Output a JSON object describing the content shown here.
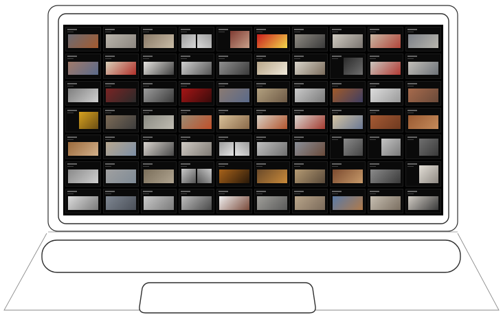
{
  "screen": {
    "rows": 7,
    "cols": 10,
    "slides": [
      {
        "layout": "wide",
        "bg": "#0a0a0a",
        "photo": "#6b6b73",
        "accent": "#a35a2e"
      },
      {
        "layout": "wide",
        "bg": "#0a0a0a",
        "photo": "#b9b4aa",
        "accent": "#8c8680"
      },
      {
        "layout": "wide",
        "bg": "#0a0a0a",
        "photo": "#8a7a68",
        "accent": "#c9bca6"
      },
      {
        "layout": "split",
        "bg": "#0a0a0a",
        "photo": "#9d9d9d",
        "accent": "#d8d8d8"
      },
      {
        "layout": "right",
        "bg": "#0a0a0a",
        "photo": "#7f3b32",
        "accent": "#c9a08a"
      },
      {
        "layout": "wide",
        "bg": "#0a0a0a",
        "photo": "#c91d1d",
        "accent": "#f2d84b"
      },
      {
        "layout": "wide",
        "bg": "#0a0a0a",
        "photo": "#8e8a82",
        "accent": "#3a3a3a"
      },
      {
        "layout": "wide",
        "bg": "#0a0a0a",
        "photo": "#cfcac0",
        "accent": "#7a7570"
      },
      {
        "layout": "wide",
        "bg": "#0a0a0a",
        "photo": "#c9b7a3",
        "accent": "#b2453a"
      },
      {
        "layout": "wide",
        "bg": "#0a0a0a",
        "photo": "#7c8087",
        "accent": "#b8b6ae"
      },
      {
        "layout": "wide",
        "bg": "#0a0a0a",
        "photo": "#a07a6a",
        "accent": "#5a6a8a"
      },
      {
        "layout": "wide",
        "bg": "#0a0a0a",
        "photo": "#d9cfb8",
        "accent": "#b0302a"
      },
      {
        "layout": "wide",
        "bg": "#0a0a0a",
        "photo": "#e6e4e0",
        "accent": "#404040"
      },
      {
        "layout": "wide",
        "bg": "#0a0a0a",
        "photo": "#cfcfcf",
        "accent": "#555555"
      },
      {
        "layout": "wide",
        "bg": "#0a0a0a",
        "photo": "#8f8f8f",
        "accent": "#3a3a3a"
      },
      {
        "layout": "wide",
        "bg": "#0a0a0a",
        "photo": "#b9a78a",
        "accent": "#efe8da"
      },
      {
        "layout": "wide",
        "bg": "#0a0a0a",
        "photo": "#d8d4ca",
        "accent": "#7a6c5c"
      },
      {
        "layout": "right",
        "bg": "#0a0a0a",
        "photo": "#2a2a2a",
        "accent": "#6f6f6f"
      },
      {
        "layout": "wide",
        "bg": "#0a0a0a",
        "photo": "#c9c5bd",
        "accent": "#b23a34"
      },
      {
        "layout": "wide",
        "bg": "#0a0a0a",
        "photo": "#c2bfb9",
        "accent": "#6d7278"
      },
      {
        "layout": "wide",
        "bg": "#0a0a0a",
        "photo": "#7f7f7f",
        "accent": "#d0d0d0"
      },
      {
        "layout": "wide",
        "bg": "#0a0a0a",
        "photo": "#7a2424",
        "accent": "#2a2a2a"
      },
      {
        "layout": "wide",
        "bg": "#0a0a0a",
        "photo": "#9c9c9c",
        "accent": "#3b3b3b"
      },
      {
        "layout": "wide",
        "bg": "#0a0a0a",
        "photo": "#a51616",
        "accent": "#3a0b0b"
      },
      {
        "layout": "wide",
        "bg": "#0a0a0a",
        "photo": "#8a7a72",
        "accent": "#5a6a8a"
      },
      {
        "layout": "wide",
        "bg": "#0a0a0a",
        "photo": "#b2a07f",
        "accent": "#6e5a46"
      },
      {
        "layout": "wide",
        "bg": "#0a0a0a",
        "photo": "#c9c9c9",
        "accent": "#7b7b7b"
      },
      {
        "layout": "wide",
        "bg": "#0a0a0a",
        "photo": "#a05a2a",
        "accent": "#3f3f63"
      },
      {
        "layout": "wide",
        "bg": "#0a0a0a",
        "photo": "#dcdcdc",
        "accent": "#9b9b9b"
      },
      {
        "layout": "wide",
        "bg": "#0a0a0a",
        "photo": "#a66a4c",
        "accent": "#6a4a3a"
      },
      {
        "layout": "right",
        "bg": "#0a0a0a",
        "photo": "#d6a11f",
        "accent": "#6b4e14"
      },
      {
        "layout": "wide",
        "bg": "#0a0a0a",
        "photo": "#7b6a56",
        "accent": "#3d3d3d"
      },
      {
        "layout": "wide",
        "bg": "#0a0a0a",
        "photo": "#8b8b83",
        "accent": "#c0bcb2"
      },
      {
        "layout": "wide",
        "bg": "#0a0a0a",
        "photo": "#9a8b73",
        "accent": "#c0502a"
      },
      {
        "layout": "wide",
        "bg": "#0a0a0a",
        "photo": "#d8c098",
        "accent": "#8a6a4a"
      },
      {
        "layout": "wide",
        "bg": "#0a0a0a",
        "photo": "#d7cfc3",
        "accent": "#b3562f"
      },
      {
        "layout": "wide",
        "bg": "#0a0a0a",
        "photo": "#d9d5cf",
        "accent": "#a33b30"
      },
      {
        "layout": "wide",
        "bg": "#0a0a0a",
        "photo": "#d3c3a3",
        "accent": "#6a7894"
      },
      {
        "layout": "wide",
        "bg": "#0a0a0a",
        "photo": "#a55a34",
        "accent": "#6f3a20"
      },
      {
        "layout": "wide",
        "bg": "#0a0a0a",
        "photo": "#9a5a32",
        "accent": "#c48a5a"
      },
      {
        "layout": "wide",
        "bg": "#0a0a0a",
        "photo": "#9b6a3c",
        "accent": "#d2b08a"
      },
      {
        "layout": "wide",
        "bg": "#0a0a0a",
        "photo": "#b8a890",
        "accent": "#7c8fa6"
      },
      {
        "layout": "wide",
        "bg": "#0a0a0a",
        "photo": "#d9d4ce",
        "accent": "#4a4a4a"
      },
      {
        "layout": "wide",
        "bg": "#0a0a0a",
        "photo": "#cfcac3",
        "accent": "#7f7a74"
      },
      {
        "layout": "split",
        "bg": "#0a0a0a",
        "photo": "#9d9d9d",
        "accent": "#e3e3e3"
      },
      {
        "layout": "wide",
        "bg": "#0a0a0a",
        "photo": "#bfbfbf",
        "accent": "#6f6f6f"
      },
      {
        "layout": "wide",
        "bg": "#0a0a0a",
        "photo": "#8a8f98",
        "accent": "#6a4a3a"
      },
      {
        "layout": "right",
        "bg": "#0a0a0a",
        "photo": "#8a8a8a",
        "accent": "#444444"
      },
      {
        "layout": "right",
        "bg": "#0a0a0a",
        "photo": "#c3c3c3",
        "accent": "#7a7a7a"
      },
      {
        "layout": "right",
        "bg": "#0a0a0a",
        "photo": "#6f6f6f",
        "accent": "#3a3a3a"
      },
      {
        "layout": "wide",
        "bg": "#0a0a0a",
        "photo": "#8a8a8a",
        "accent": "#cfcfcf"
      },
      {
        "layout": "wide",
        "bg": "#0a0a0a",
        "photo": "#a0a0a0",
        "accent": "#7f8b96"
      },
      {
        "layout": "wide",
        "bg": "#0a0a0a",
        "photo": "#7a6e5a",
        "accent": "#b0a490"
      },
      {
        "layout": "split",
        "bg": "#0a0a0a",
        "photo": "#c9c9c9",
        "accent": "#555555"
      },
      {
        "layout": "wide",
        "bg": "#0a0a0a",
        "photo": "#a8621a",
        "accent": "#2a1a0a"
      },
      {
        "layout": "wide",
        "bg": "#0a0a0a",
        "photo": "#6a4a2a",
        "accent": "#c98a3a"
      },
      {
        "layout": "wide",
        "bg": "#0a0a0a",
        "photo": "#b49a73",
        "accent": "#5a4a3a"
      },
      {
        "layout": "wide",
        "bg": "#0a0a0a",
        "photo": "#7b4a2f",
        "accent": "#c79a6a"
      },
      {
        "layout": "wide",
        "bg": "#0a0a0a",
        "photo": "#8a8a8a",
        "accent": "#3a3a3a"
      },
      {
        "layout": "right",
        "bg": "#0a0a0a",
        "photo": "#e2ded6",
        "accent": "#8f8a84"
      },
      {
        "layout": "wide",
        "bg": "#0a0a0a",
        "photo": "#dcdcdc",
        "accent": "#7a7a7a"
      },
      {
        "layout": "wide",
        "bg": "#0a0a0a",
        "photo": "#7f8792",
        "accent": "#4a4f58"
      },
      {
        "layout": "wide",
        "bg": "#0a0a0a",
        "photo": "#c9c9c9",
        "accent": "#7a7a7a"
      },
      {
        "layout": "wide",
        "bg": "#0a0a0a",
        "photo": "#bcbcbc",
        "accent": "#4a4a4a"
      },
      {
        "layout": "wide",
        "bg": "#0a0a0a",
        "photo": "#efefef",
        "accent": "#7a4a3a"
      },
      {
        "layout": "wide",
        "bg": "#0a0a0a",
        "photo": "#a09f9a",
        "accent": "#5a5a5a"
      },
      {
        "layout": "wide",
        "bg": "#0a0a0a",
        "photo": "#b9a58a",
        "accent": "#7a6a5a"
      },
      {
        "layout": "wide",
        "bg": "#0a0a0a",
        "photo": "#5a7aa6",
        "accent": "#b07a4a"
      },
      {
        "layout": "wide",
        "bg": "#0a0a0a",
        "photo": "#c7bfb2",
        "accent": "#7a6e60"
      },
      {
        "layout": "wide",
        "bg": "#0a0a0a",
        "photo": "#d1ccc4",
        "accent": "#3a3a3a"
      }
    ]
  }
}
